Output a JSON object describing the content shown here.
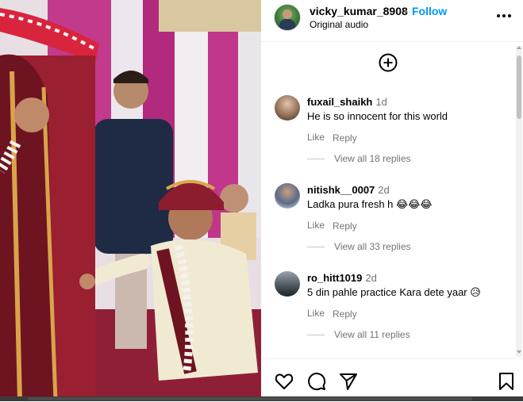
{
  "header": {
    "username": "vicky_kumar_8908",
    "separator": "•",
    "follow_label": "Follow",
    "audio": "Original audio"
  },
  "icons": {
    "more": "more-horizontal-icon",
    "add": "plus-circle-icon",
    "like": "heart-icon",
    "comment": "comment-bubble-icon",
    "share": "paper-plane-icon",
    "save": "bookmark-icon"
  },
  "comments": [
    {
      "username": "fuxail_shaikh",
      "time": "1d",
      "text": "He is so innocent for this world",
      "like_label": "Like",
      "reply_label": "Reply",
      "view_replies": "View all 18 replies"
    },
    {
      "username": "nitishk__0007",
      "time": "2d",
      "text": "Ladka pura fresh h 😂😂😂",
      "like_label": "Like",
      "reply_label": "Reply",
      "view_replies": "View all 33 replies"
    },
    {
      "username": "ro_hitt1019",
      "time": "2d",
      "text": "5 din pahle practice Kara dete yaar 😥",
      "like_label": "Like",
      "reply_label": "Reply",
      "view_replies": "View all 11 replies"
    }
  ],
  "colors": {
    "accent": "#0095f6",
    "secondary_text": "#737373"
  }
}
